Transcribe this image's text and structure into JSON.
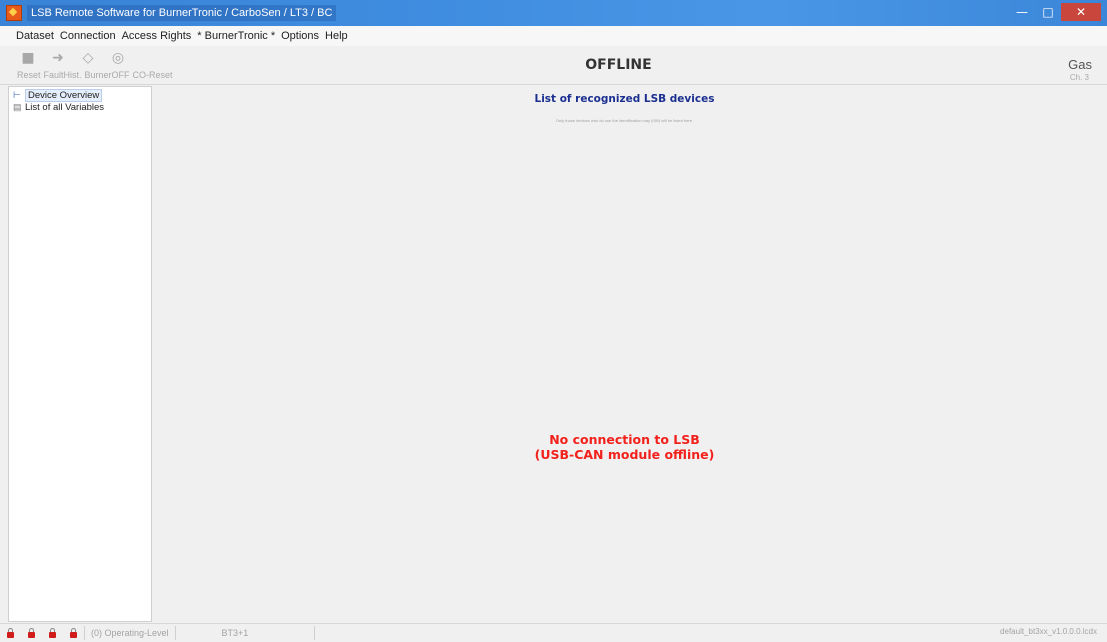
{
  "window": {
    "title": "LSB Remote Software for BurnerTronic / CarboSen / LT3 / BC",
    "controls": {
      "minimize": "—",
      "maximize": "□",
      "close": "✕"
    }
  },
  "menu": [
    "Dataset",
    "Connection",
    "Access Rights",
    "* BurnerTronic *",
    "Options",
    "Help"
  ],
  "toolbar": {
    "buttons": [
      {
        "icon": "reset-icon",
        "label": "Reset"
      },
      {
        "icon": "fault-history-icon",
        "label": "FaultHist."
      },
      {
        "icon": "burner-off-icon",
        "label": "BurnerOFF"
      },
      {
        "icon": "co-reset-icon",
        "label": "CO-Reset"
      }
    ]
  },
  "header": {
    "status": "OFFLINE",
    "fuel": "Gas",
    "fuel_sub": "Ch. 3"
  },
  "sidebar": {
    "items": [
      {
        "icon": "device-tree-icon",
        "label": "Device Overview",
        "selected": true
      },
      {
        "icon": "variables-list-icon",
        "label": "List of all Variables",
        "selected": false
      }
    ]
  },
  "main": {
    "heading": "List of recognized LSB devices",
    "note": "Only those devices who do use the identification may (ISB) will be listed here.",
    "error_line1": "No connection to LSB",
    "error_line2": "(USB-CAN module offline)"
  },
  "statusbar": {
    "operating_level": "(0) Operating-Level",
    "device": "BT3+1",
    "file": "default_bt3xx_v1.0.0.0.lcdx"
  },
  "colors": {
    "title_bar": "#3f8de0",
    "error_text": "#f2211c",
    "heading_text": "#1a2f90",
    "lock_red": "#d11c1c"
  }
}
